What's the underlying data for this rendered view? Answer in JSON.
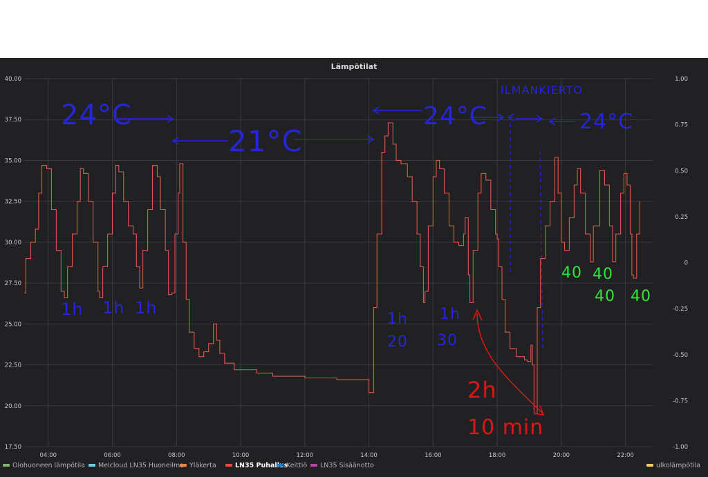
{
  "panel": {
    "title": "Lämpötilat"
  },
  "chart_data": {
    "type": "line",
    "title": "Lämpötilat",
    "xlabel": "",
    "ylabel": "",
    "x_ticks": [
      "04:00",
      "06:00",
      "08:00",
      "10:00",
      "12:00",
      "14:00",
      "16:00",
      "18:00",
      "20:00",
      "22:00"
    ],
    "x_range_hours": [
      3.25,
      22.85
    ],
    "y_left_ticks": [
      "17.50",
      "20.00",
      "22.50",
      "25.00",
      "27.50",
      "30.00",
      "32.50",
      "35.00",
      "37.50",
      "40.00"
    ],
    "ylim": [
      17.5,
      40
    ],
    "y_right_ticks": [
      "-1.00",
      "-0.75",
      "-0.50",
      "-0.25",
      "0",
      "0.25",
      "0.50",
      "0.75",
      "1.00"
    ],
    "y2lim": [
      -1,
      1
    ],
    "grid": true,
    "legend_position": "bottom",
    "series": [
      {
        "name": "LN35 Puhallus",
        "color": "#e0574c",
        "points": [
          [
            3.25,
            26.9
          ],
          [
            3.3,
            29.0
          ],
          [
            3.45,
            30.0
          ],
          [
            3.6,
            30.8
          ],
          [
            3.7,
            33.0
          ],
          [
            3.8,
            34.7
          ],
          [
            3.95,
            34.5
          ],
          [
            4.1,
            32.0
          ],
          [
            4.25,
            29.5
          ],
          [
            4.4,
            27.0
          ],
          [
            4.5,
            26.6
          ],
          [
            4.6,
            28.5
          ],
          [
            4.75,
            30.5
          ],
          [
            4.9,
            32.5
          ],
          [
            5.0,
            34.5
          ],
          [
            5.1,
            34.2
          ],
          [
            5.25,
            32.5
          ],
          [
            5.4,
            30.0
          ],
          [
            5.55,
            27.0
          ],
          [
            5.6,
            26.6
          ],
          [
            5.7,
            28.5
          ],
          [
            5.85,
            30.5
          ],
          [
            6.0,
            33.0
          ],
          [
            6.1,
            34.7
          ],
          [
            6.2,
            34.3
          ],
          [
            6.35,
            32.5
          ],
          [
            6.5,
            31.0
          ],
          [
            6.65,
            30.5
          ],
          [
            6.75,
            28.5
          ],
          [
            6.85,
            27.2
          ],
          [
            6.95,
            29.5
          ],
          [
            7.1,
            32.0
          ],
          [
            7.25,
            34.7
          ],
          [
            7.4,
            34.0
          ],
          [
            7.5,
            32.0
          ],
          [
            7.65,
            29.5
          ],
          [
            7.75,
            26.8
          ],
          [
            7.85,
            26.9
          ],
          [
            7.95,
            30.5
          ],
          [
            8.05,
            33.0
          ],
          [
            8.1,
            34.8
          ],
          [
            8.2,
            30.0
          ],
          [
            8.3,
            26.5
          ],
          [
            8.4,
            24.5
          ],
          [
            8.55,
            23.5
          ],
          [
            8.7,
            23.0
          ],
          [
            8.85,
            23.3
          ],
          [
            9.0,
            23.8
          ],
          [
            9.15,
            25.0
          ],
          [
            9.25,
            24.0
          ],
          [
            9.35,
            23.2
          ],
          [
            9.5,
            22.6
          ],
          [
            9.8,
            22.2
          ],
          [
            10.5,
            22.0
          ],
          [
            11.0,
            21.8
          ],
          [
            12.0,
            21.7
          ],
          [
            13.0,
            21.6
          ],
          [
            13.9,
            21.6
          ],
          [
            14.0,
            20.8
          ],
          [
            14.1,
            20.8
          ],
          [
            14.15,
            26.0
          ],
          [
            14.25,
            30.5
          ],
          [
            14.4,
            35.5
          ],
          [
            14.5,
            36.5
          ],
          [
            14.6,
            37.3
          ],
          [
            14.75,
            36.0
          ],
          [
            14.85,
            35.0
          ],
          [
            15.0,
            34.8
          ],
          [
            15.2,
            34.0
          ],
          [
            15.35,
            32.5
          ],
          [
            15.5,
            30.5
          ],
          [
            15.6,
            28.5
          ],
          [
            15.7,
            26.3
          ],
          [
            15.75,
            27.0
          ],
          [
            15.85,
            31.0
          ],
          [
            16.0,
            34.0
          ],
          [
            16.1,
            35.0
          ],
          [
            16.2,
            34.5
          ],
          [
            16.35,
            33.0
          ],
          [
            16.5,
            31.0
          ],
          [
            16.65,
            30.0
          ],
          [
            16.8,
            29.8
          ],
          [
            16.95,
            30.5
          ],
          [
            17.0,
            31.5
          ],
          [
            17.1,
            28.0
          ],
          [
            17.15,
            26.3
          ],
          [
            17.25,
            29.5
          ],
          [
            17.4,
            33.0
          ],
          [
            17.5,
            34.2
          ],
          [
            17.65,
            33.8
          ],
          [
            17.8,
            32.0
          ],
          [
            17.95,
            30.5
          ],
          [
            18.0,
            30.2
          ],
          [
            18.05,
            28.5
          ],
          [
            18.15,
            26.5
          ],
          [
            18.25,
            24.5
          ],
          [
            18.4,
            23.5
          ],
          [
            18.6,
            23.0
          ],
          [
            18.85,
            22.8
          ],
          [
            18.95,
            22.7
          ],
          [
            19.05,
            23.7
          ],
          [
            19.1,
            22.5
          ],
          [
            19.15,
            19.5
          ],
          [
            19.22,
            19.5
          ],
          [
            19.25,
            26.0
          ],
          [
            19.35,
            29.0
          ],
          [
            19.5,
            31.0
          ],
          [
            19.65,
            32.5
          ],
          [
            19.8,
            35.2
          ],
          [
            19.9,
            33.0
          ],
          [
            20.0,
            30.0
          ],
          [
            20.1,
            29.5
          ],
          [
            20.25,
            31.5
          ],
          [
            20.4,
            33.5
          ],
          [
            20.5,
            34.5
          ],
          [
            20.6,
            33.0
          ],
          [
            20.75,
            30.5
          ],
          [
            20.9,
            28.8
          ],
          [
            21.0,
            31.0
          ],
          [
            21.2,
            34.4
          ],
          [
            21.35,
            33.5
          ],
          [
            21.5,
            31.0
          ],
          [
            21.6,
            28.8
          ],
          [
            21.7,
            30.5
          ],
          [
            21.85,
            33.0
          ],
          [
            21.95,
            34.2
          ],
          [
            22.05,
            33.5
          ],
          [
            22.15,
            30.5
          ],
          [
            22.2,
            28.0
          ],
          [
            22.25,
            27.8
          ],
          [
            22.35,
            30.5
          ],
          [
            22.45,
            32.5
          ]
        ]
      }
    ],
    "legend": [
      {
        "name": "Olohuoneen lämpötila",
        "color": "#7eb26d"
      },
      {
        "name": "Melcloud LN35 Huoneilma",
        "color": "#6ed0e0"
      },
      {
        "name": "Yläkerta",
        "color": "#ef843c"
      },
      {
        "name": "LN35 Puhallus",
        "color": "#e24d42"
      },
      {
        "name": "Keittiö",
        "color": "#1f78c1"
      },
      {
        "name": "LN35 Sisäänotto",
        "color": "#ba43a9"
      },
      {
        "name": "ulkolämpötila",
        "color": "#f2c96d"
      }
    ],
    "annotations": [
      {
        "text": "24°C",
        "color": "#2525d9"
      },
      {
        "text": "21°C",
        "color": "#2525d9"
      },
      {
        "text": "24°C",
        "color": "#2525d9"
      },
      {
        "text": "24°C",
        "color": "#2525d9"
      },
      {
        "text": "ILMANKIERTO",
        "color": "#2525d9"
      },
      {
        "text": "1h",
        "color": "#2525d9"
      },
      {
        "text": "1h",
        "color": "#2525d9"
      },
      {
        "text": "1h",
        "color": "#2525d9"
      },
      {
        "text": "1h",
        "color": "#2525d9"
      },
      {
        "text": "20",
        "color": "#2525d9"
      },
      {
        "text": "1h",
        "color": "#2525d9"
      },
      {
        "text": "30",
        "color": "#2525d9"
      },
      {
        "text": "2h",
        "color": "#e01515"
      },
      {
        "text": "10 min",
        "color": "#e01515"
      },
      {
        "text": "40",
        "color": "#2ee63a"
      },
      {
        "text": "40",
        "color": "#2ee63a"
      },
      {
        "text": "40",
        "color": "#2ee63a"
      },
      {
        "text": "40",
        "color": "#2ee63a"
      }
    ]
  }
}
